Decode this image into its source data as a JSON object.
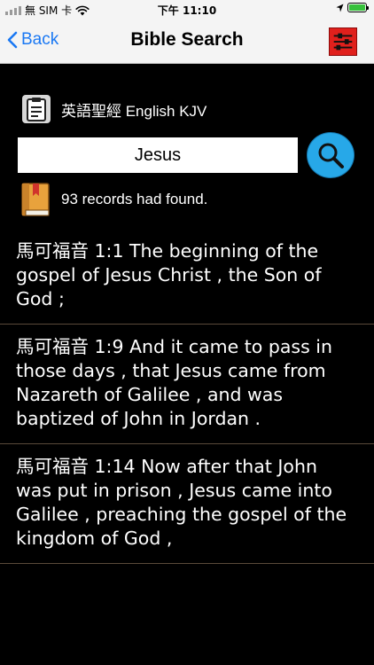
{
  "status_bar": {
    "carrier": "無 SIM 卡",
    "time": "下午 11:10"
  },
  "nav": {
    "back_label": "Back",
    "title": "Bible Search"
  },
  "version": {
    "label": "英語聖經 English KJV"
  },
  "search": {
    "query": "Jesus"
  },
  "result_count": {
    "text": "93 records had found."
  },
  "results": [
    {
      "text": "馬可福音 1:1 The beginning of the gospel of Jesus Christ , the Son of God ;"
    },
    {
      "text": "馬可福音 1:9 And it came to pass in those days , that Jesus came from Nazareth of Galilee , and was baptized of John in Jordan ."
    },
    {
      "text": "馬可福音 1:14 Now after that John was put in prison , Jesus came into Galilee , preaching the gospel of the kingdom of God ,"
    }
  ],
  "colors": {
    "accent": "#1a78f3",
    "settings_button": "#e0201c",
    "search_button": "#27a8e8",
    "background": "#000000",
    "separator": "#5a4a3a",
    "battery": "#36c13b"
  },
  "icons": {
    "back": "chevron-left-icon",
    "settings": "sliders-icon",
    "version": "clipboard-icon",
    "search": "magnifier-icon",
    "count": "book-icon",
    "wifi": "wifi-icon",
    "battery": "battery-icon"
  }
}
